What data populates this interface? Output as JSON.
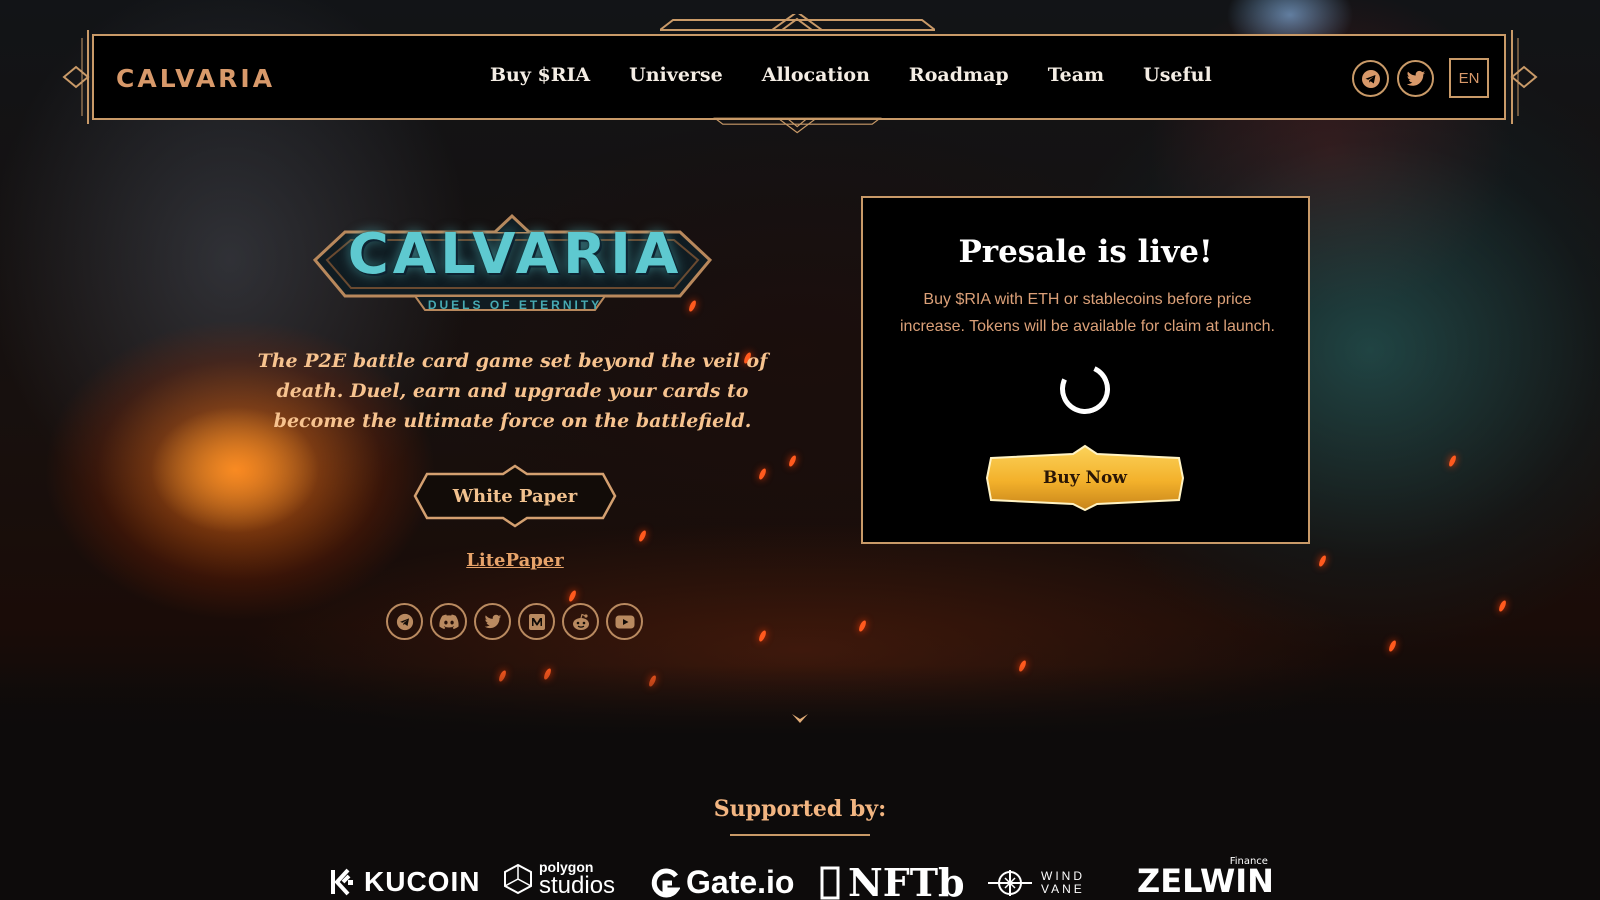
{
  "nav": {
    "logo": "CALVARIA",
    "menu": [
      "Buy $RIA",
      "Universe",
      "Allocation",
      "Roadmap",
      "Team",
      "Useful"
    ],
    "icons": [
      "telegram-icon",
      "twitter-icon"
    ],
    "language": "EN"
  },
  "hero": {
    "game_title": "CALVARIA",
    "game_subtitle": "DUELS OF ETERNITY",
    "tagline": "The P2E battle card game set beyond the veil of death. Duel, earn and upgrade your cards to become the ultimate force on the battlefield.",
    "white_paper_label": "White Paper",
    "lite_paper_label": "LitePaper",
    "socials": [
      "telegram-icon",
      "discord-icon",
      "twitter-icon",
      "medium-icon",
      "reddit-icon",
      "youtube-icon"
    ]
  },
  "presale": {
    "title": "Presale is live!",
    "description": "Buy $RIA with ETH or stablecoins before price increase. Tokens will be available for claim at launch.",
    "buy_label": "Buy Now"
  },
  "supported": {
    "heading": "Supported by:",
    "partners": {
      "kucoin": "KUCOIN",
      "polygon_small": "polygon",
      "polygon_big": "studios",
      "gate": "Gate.io",
      "nftb": "NFTb",
      "wind_1": "WIND",
      "wind_2": "VANE",
      "zelwin": "ZELWIN",
      "zelwin_sub": "Finance"
    }
  },
  "colors": {
    "accent": "#c99a68",
    "gold_button": "#f3b12b",
    "title_cyan": "#5ec9d0",
    "tagline": "#f7c38f"
  }
}
